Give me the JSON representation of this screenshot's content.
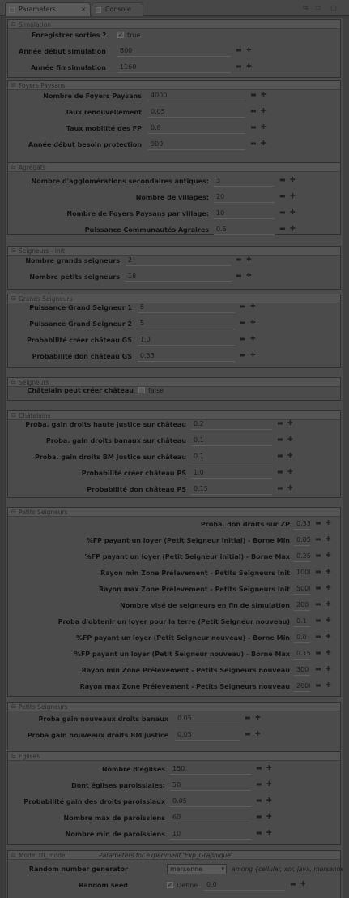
{
  "tabs": {
    "parameters": "Parameters",
    "console": "Console"
  },
  "sections": [
    {
      "title": "Simulation",
      "rows": [
        {
          "label": "Enregistrer sorties ?",
          "checked": true,
          "value": "true"
        },
        {
          "label": "Année début simulation",
          "value": "800"
        },
        {
          "label": "Année fin simulation",
          "value": "1160"
        }
      ]
    },
    {
      "title": "Foyers Paysans",
      "rows": [
        {
          "label": "Nombre de Foyers Paysans",
          "value": "4000"
        },
        {
          "label": "Taux renouvellement",
          "value": "0.05"
        },
        {
          "label": "Taux mobilité des FP",
          "value": "0.8"
        },
        {
          "label": "Année début besoin protection",
          "value": "900"
        }
      ]
    },
    {
      "title": "Agrégats",
      "rows": [
        {
          "label": "Nombre d'agglomérations secondaires antiques:",
          "value": "3"
        },
        {
          "label": "Nombre de villages:",
          "value": "20"
        },
        {
          "label": "Nombre de Foyers Paysans par village:",
          "value": "10"
        },
        {
          "label": "Puissance Communautés Agraires",
          "value": "0.5"
        }
      ]
    },
    {
      "title": "Seigneurs - Init",
      "rows": [
        {
          "label": "Nombre grands seigneurs",
          "value": "2"
        },
        {
          "label": "Nombre petits seigneurs",
          "value": "18"
        }
      ]
    },
    {
      "title": "Grands Seigneurs",
      "rows": [
        {
          "label": "Puissance Grand Seigneur 1",
          "value": "5"
        },
        {
          "label": "Puissance Grand Seigneur 2",
          "value": "5"
        },
        {
          "label": "Probabilité créer château GS",
          "value": "1.0"
        },
        {
          "label": "Probabilité don château GS",
          "value": "0.33"
        }
      ]
    },
    {
      "title": "Seigneurs",
      "rows": [
        {
          "label": "Châtelain peut créer château",
          "checked": false,
          "value": "false"
        }
      ]
    },
    {
      "title": "Châtelains",
      "rows": [
        {
          "label": "Proba. gain droits haute justice sur château",
          "value": "0.2"
        },
        {
          "label": "Proba. gain droits banaux sur château",
          "value": "0.1"
        },
        {
          "label": "Proba. gain droits BM Justice sur château",
          "value": "0.1"
        },
        {
          "label": "Probabilité créer château PS",
          "value": "1.0"
        },
        {
          "label": "Probabilité don château PS",
          "value": "0.15"
        }
      ]
    },
    {
      "title": "Petits Seigneurs",
      "rows": [
        {
          "label": "Proba. don droits sur ZP",
          "value": "0.33"
        },
        {
          "label": "%FP payant un loyer (Petit Seigneur initial) - Borne Min",
          "value": "0.05"
        },
        {
          "label": "%FP payant un loyer (Petit Seigneur initial) - Borne Max",
          "value": "0.25"
        },
        {
          "label": "Rayon min Zone Prélevement - Petits Seigneurs Init",
          "value": "1000"
        },
        {
          "label": "Rayon max Zone Prélevement - Petits Seigneurs Init",
          "value": "5000"
        },
        {
          "label": "Nombre visé de seigneurs en fin de simulation",
          "value": "200"
        },
        {
          "label": "Proba d'obtenir un loyer pour la terre (Petit Seigneur nouveau)",
          "value": "0.1"
        },
        {
          "label": "%FP payant un loyer (Petit Seigneur nouveau) - Borne Min",
          "value": "0.0"
        },
        {
          "label": "%FP payant un loyer (Petit Seigneur nouveau) - Borne Max",
          "value": "0.15"
        },
        {
          "label": "Rayon min Zone Prélevement - Petits Seigneurs nouveau",
          "value": "300"
        },
        {
          "label": "Rayon max Zone Prélevement - Petits Seigneurs nouveau",
          "value": "2000"
        }
      ]
    },
    {
      "title": "Petits Seigneurs",
      "rows": [
        {
          "label": "Proba gain nouveaux droits banaux",
          "value": "0.05"
        },
        {
          "label": "Proba gain nouveaux droits BM justice",
          "value": "0.05"
        }
      ]
    },
    {
      "title": "Eglises",
      "rows": [
        {
          "label": "Nombre d'églises",
          "value": "150"
        },
        {
          "label": "Dont églises paroissiales:",
          "value": "50"
        },
        {
          "label": "Probabilité gain des droits paroissiaux",
          "value": "0.05"
        },
        {
          "label": "Nombre max de paroissiens",
          "value": "60"
        },
        {
          "label": "Nombre min de paroissiens",
          "value": "10"
        }
      ]
    },
    {
      "title": "Model tfl_model",
      "subtitle": "Parameters for experiment 'Exp_Graphique'",
      "rows": [
        {
          "label": "Random number generator",
          "combo": "mersenne",
          "note": "among {cellular, xor, java, mersenne}"
        },
        {
          "label": "Random seed",
          "checked": true,
          "check_label": "Define",
          "value": "0.0"
        }
      ]
    }
  ],
  "icons": {
    "reset": "minus-icon",
    "add": "plus-icon",
    "twisty": "twisty-icon"
  }
}
